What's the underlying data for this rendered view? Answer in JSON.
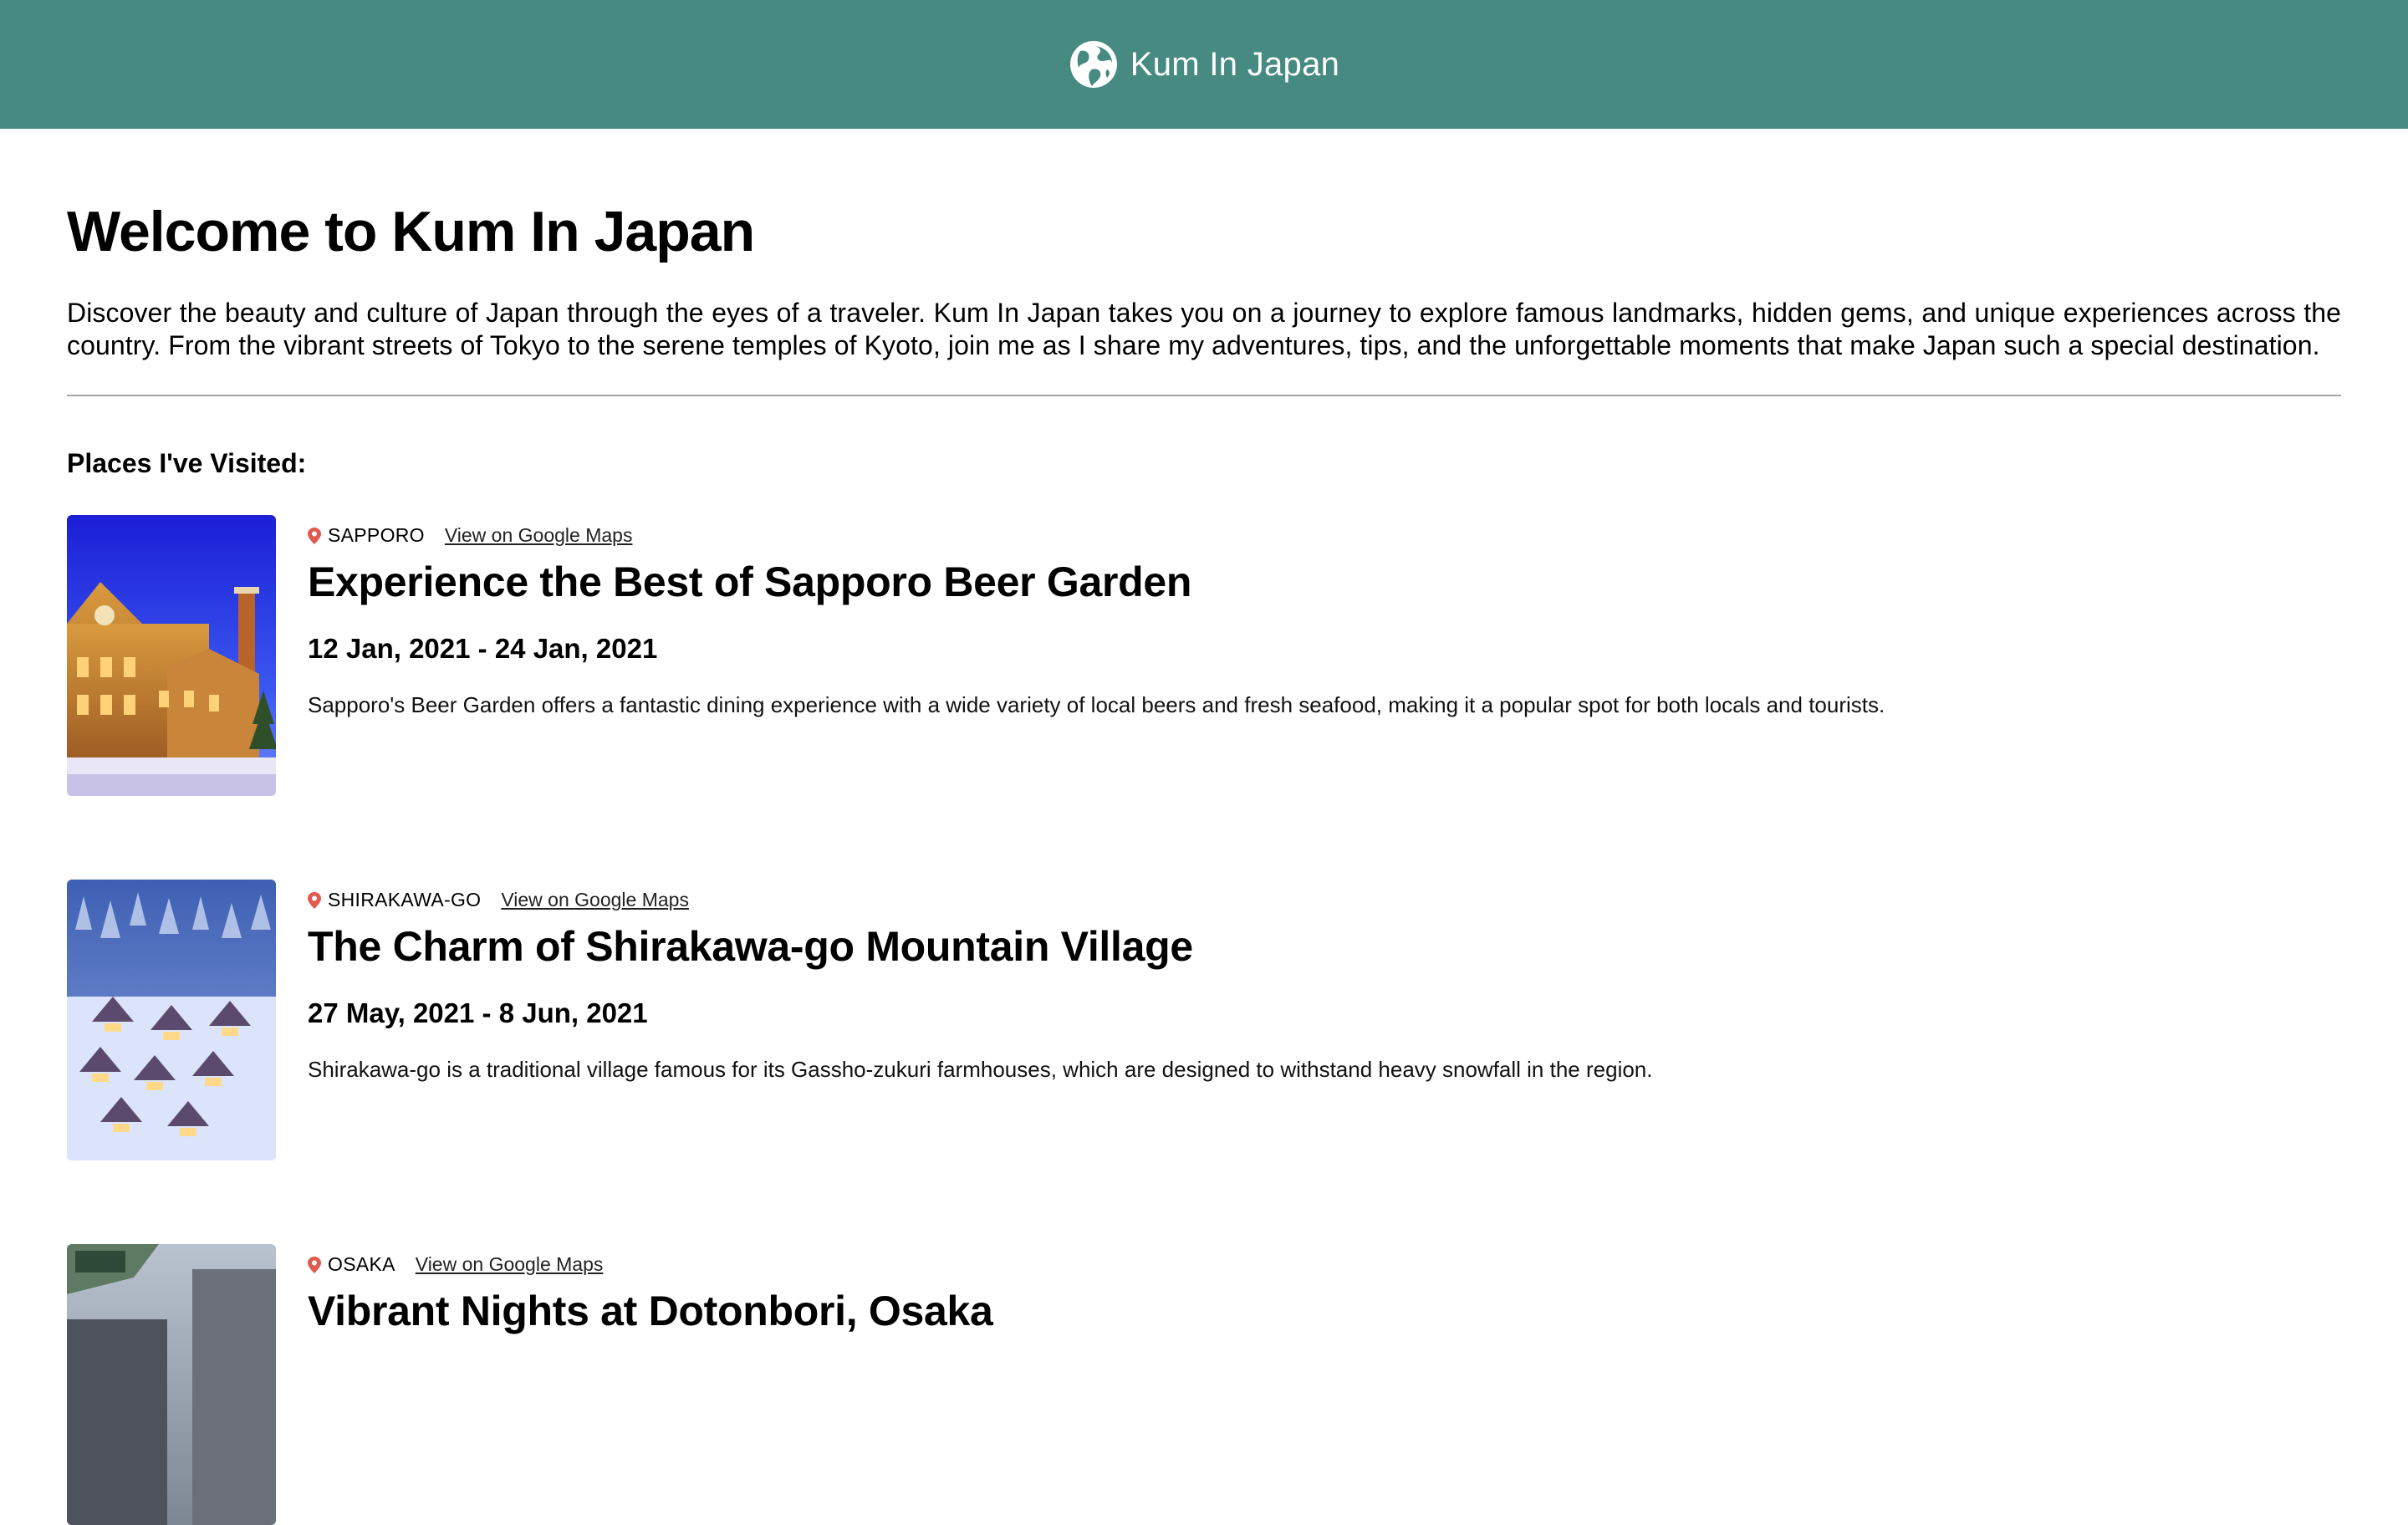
{
  "header": {
    "title": "Kum In Japan",
    "logo_icon": "globe-icon",
    "background": "#468a81"
  },
  "main": {
    "heading": "Welcome to Kum In Japan",
    "intro": "Discover the beauty and culture of Japan through the eyes of a traveler. Kum In Japan takes you on a journey to explore famous landmarks, hidden gems, and unique experiences across the country. From the vibrant streets of Tokyo to the serene temples of Kyoto, join me as I share my adventures, tips, and the unforgettable moments that make Japan such a special destination.",
    "places_heading": "Places I've Visited:"
  },
  "places": [
    {
      "city": "SAPPORO",
      "maps_label": "View on Google Maps",
      "title": "Experience the Best of Sapporo Beer Garden",
      "dates": "12 Jan, 2021 - 24 Jan, 2021",
      "description": "Sapporo's Beer Garden offers a fantastic dining experience with a wide variety of local beers and fresh seafood, making it a popular spot for both locals and tourists."
    },
    {
      "city": "SHIRAKAWA-GO",
      "maps_label": "View on Google Maps",
      "title": "The Charm of Shirakawa-go Mountain Village",
      "dates": "27 May, 2021 - 8 Jun, 2021",
      "description": "Shirakawa-go is a traditional village famous for its Gassho-zukuri farmhouses, which are designed to withstand heavy snowfall in the region."
    },
    {
      "city": "OSAKA",
      "maps_label": "View on Google Maps",
      "title": "Vibrant Nights at Dotonbori, Osaka",
      "dates": "",
      "description": ""
    }
  ],
  "icons": {
    "location": "location-pin-icon",
    "pin_color": "#e05a4f"
  }
}
